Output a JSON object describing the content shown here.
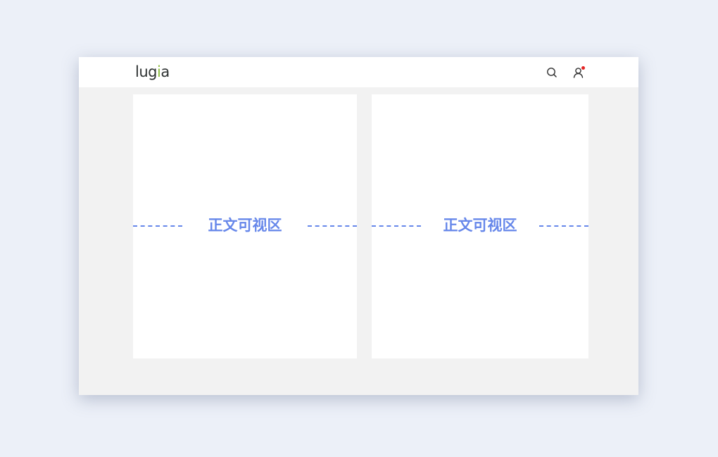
{
  "header": {
    "logo": {
      "text_start": "lug",
      "text_accent": "i",
      "text_end": "a",
      "accent_color": "#8cbd3b"
    },
    "actions": {
      "search_icon": "search-icon",
      "user_icon": "user-icon",
      "notification_color": "#e42323"
    }
  },
  "content": {
    "panels": [
      {
        "label": "正文可视区"
      },
      {
        "label": "正文可视区"
      }
    ],
    "guide_color": "#6687ea"
  },
  "colors": {
    "page_background": "#ecf0f8",
    "window_background": "#f2f2f2",
    "panel_background": "#ffffff"
  }
}
